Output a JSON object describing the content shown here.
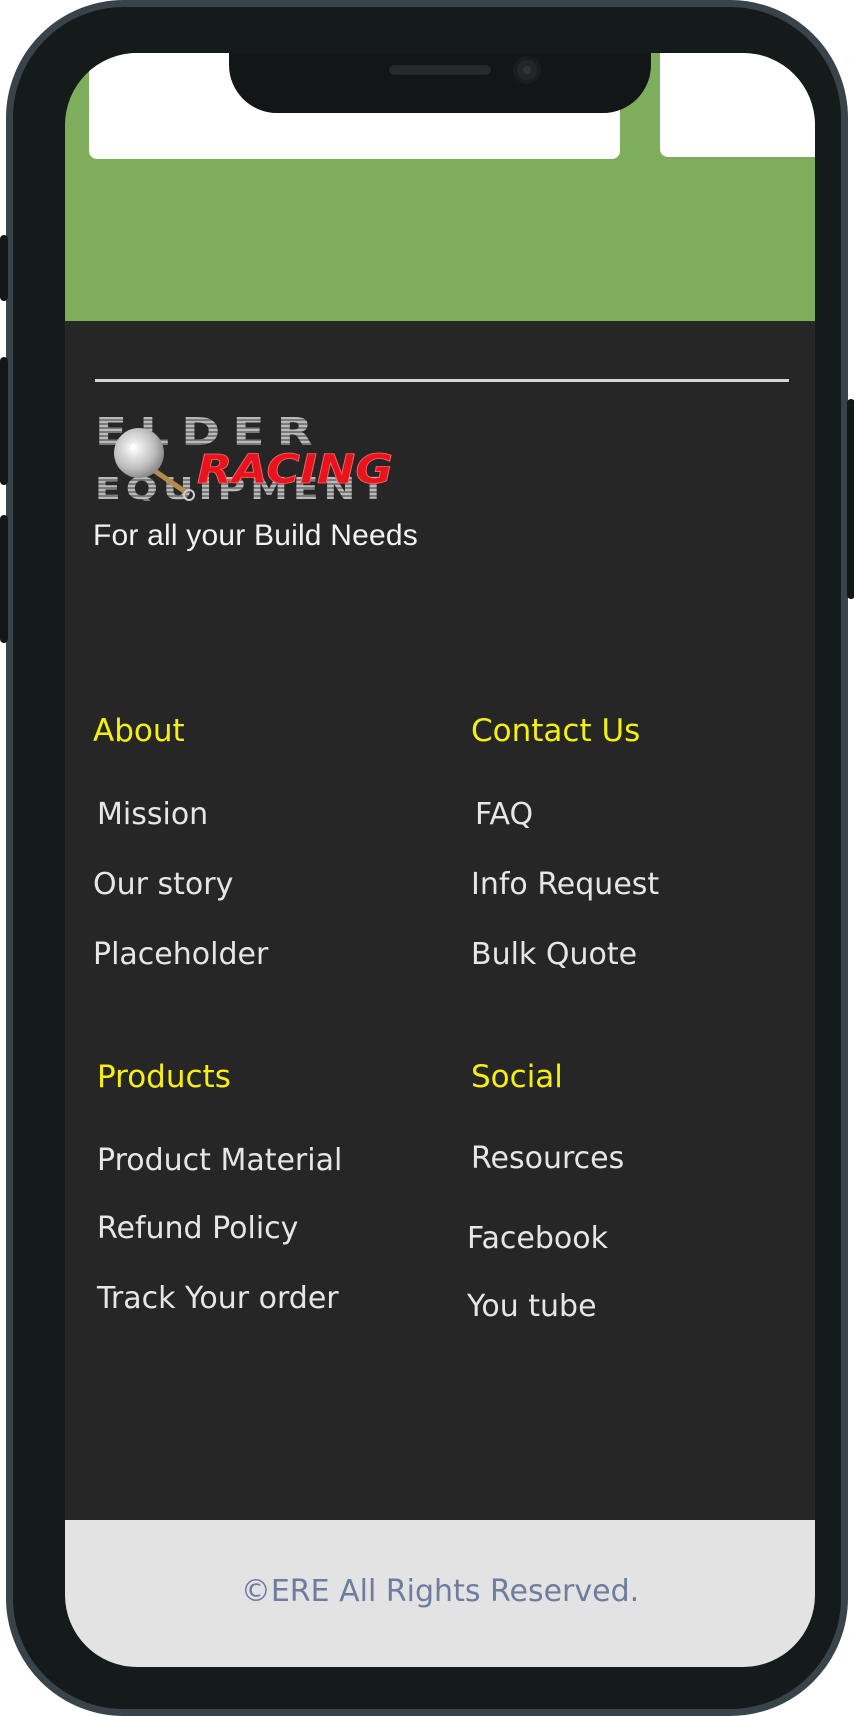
{
  "brand": {
    "logo_line1": "ELDER",
    "logo_line2": "RACING",
    "logo_line3": "EQUIPMENT",
    "tagline": "For all your Build Needs"
  },
  "footer": {
    "about": {
      "heading": "About",
      "links": [
        "Mission",
        "Our story",
        "Placeholder"
      ]
    },
    "contact": {
      "heading": "Contact Us",
      "links": [
        "FAQ",
        "Info Request",
        "Bulk Quote"
      ]
    },
    "products": {
      "heading": "Products",
      "links": [
        "Product Material",
        "Refund Policy",
        "Track Your order"
      ]
    },
    "social": {
      "heading": "Social",
      "links": [
        "Resources",
        "Facebook",
        "You tube"
      ]
    }
  },
  "copyright": "©ERE All Rights Reserved.",
  "colors": {
    "hero_green": "#7eae5b",
    "footer_bg": "#262626",
    "heading_yellow": "#f5ef12",
    "logo_red": "#e8131c",
    "copyright_blue": "#6d7da0"
  }
}
